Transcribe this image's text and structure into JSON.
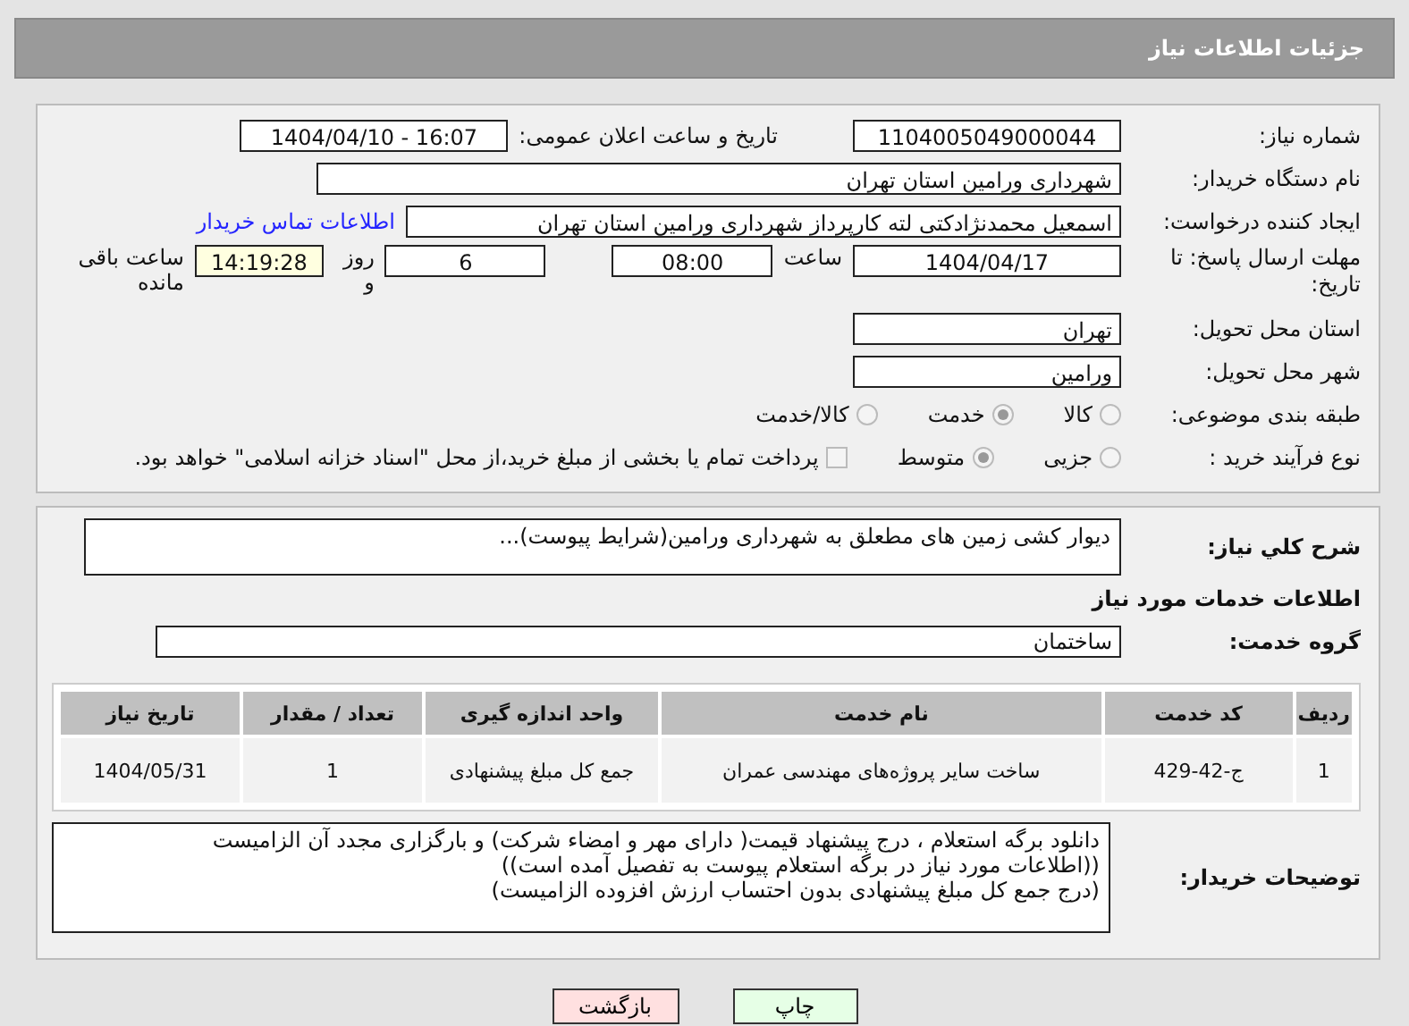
{
  "header": {
    "title": "جزئیات اطلاعات نیاز"
  },
  "need_number": {
    "label": "شماره نیاز:",
    "value": "1104005049000044"
  },
  "announce": {
    "label": "تاریخ و ساعت اعلان عمومی:",
    "value": "1404/04/10 - 16:07"
  },
  "buyer": {
    "label": "نام دستگاه خریدار:",
    "value": "شهرداری ورامین استان تهران"
  },
  "creator": {
    "label": "ایجاد کننده درخواست:",
    "value": "اسمعیل محمدنژادکتی لته کارپرداز شهرداری ورامین استان تهران",
    "link": "اطلاعات تماس خریدار"
  },
  "deadline": {
    "label": "مهلت ارسال پاسخ: تا تاریخ:",
    "date": "1404/04/17",
    "time_label": "ساعت",
    "time": "08:00",
    "days": "6",
    "days_label": "روز و",
    "remaining": "14:19:28",
    "remaining_label": "ساعت باقی مانده"
  },
  "province": {
    "label": "استان محل تحویل:",
    "value": "تهران"
  },
  "city": {
    "label": "شهر محل تحویل:",
    "value": "ورامین"
  },
  "category": {
    "label": "طبقه بندی موضوعی:",
    "options": [
      {
        "label": "کالا",
        "selected": false
      },
      {
        "label": "خدمت",
        "selected": true
      },
      {
        "label": "کالا/خدمت",
        "selected": false
      }
    ]
  },
  "process": {
    "label": "نوع فرآیند خرید :",
    "options": [
      {
        "label": "جزیی",
        "selected": false
      },
      {
        "label": "متوسط",
        "selected": true
      }
    ],
    "payment": {
      "label": "پرداخت تمام یا بخشی از مبلغ خرید،از محل \"اسناد خزانه اسلامی\" خواهد بود.",
      "checked": false
    }
  },
  "summary": {
    "label": "شرح کلي نياز:",
    "value": "دیوار کشی زمین های مطعلق به شهرداری ورامین(شرایط پیوست)..."
  },
  "services_title": "اطلاعات خدمات مورد نياز",
  "service_group": {
    "label": "گروه خدمت:",
    "value": "ساختمان"
  },
  "table": {
    "columns": [
      "ردیف",
      "کد خدمت",
      "نام خدمت",
      "واحد اندازه گیری",
      "تعداد / مقدار",
      "تاریخ نیاز"
    ],
    "rows": [
      [
        "1",
        "ج-42-429",
        "ساخت سایر پروژه‌های مهندسی عمران",
        "جمع کل مبلغ پیشنهادی",
        "1",
        "1404/05/31"
      ]
    ]
  },
  "notes": {
    "label": "توضیحات خریدار:",
    "lines": [
      "دانلود برگه استعلام ، درج پیشنهاد قیمت( دارای مهر و امضاء شرکت) و بارگزاری مجدد آن الزامیست",
      "((اطلاعات مورد نیاز در برگه استعلام پیوست به تفصیل آمده است))",
      "(درج  جمع کل مبلغ پیشنهادی بدون احتساب ارزش افزوده الزامیست)"
    ]
  },
  "buttons": [
    {
      "label": "چاپ",
      "kind": "print"
    },
    {
      "label": "بازگشت",
      "kind": "back"
    }
  ]
}
